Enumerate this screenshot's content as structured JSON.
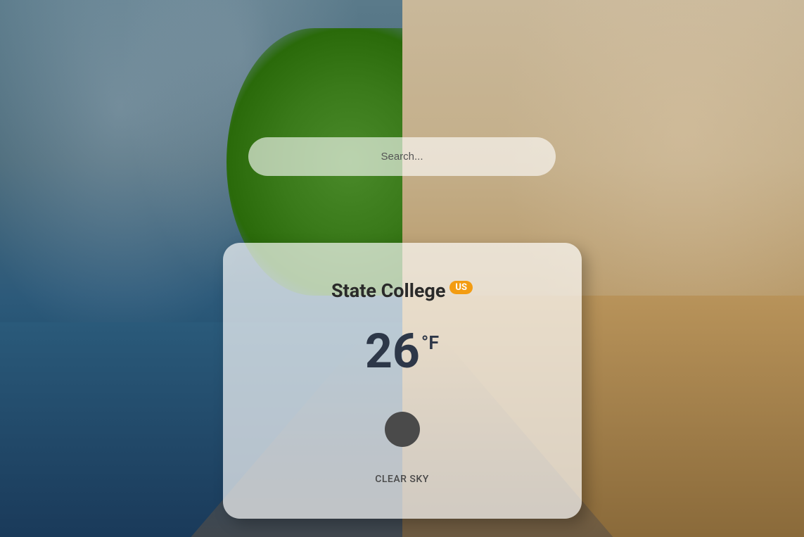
{
  "search": {
    "placeholder": "Search...",
    "value": ""
  },
  "weather": {
    "location": "State College",
    "country": "US",
    "temperature": "26",
    "unit": "°F",
    "condition": "CLEAR SKY"
  }
}
